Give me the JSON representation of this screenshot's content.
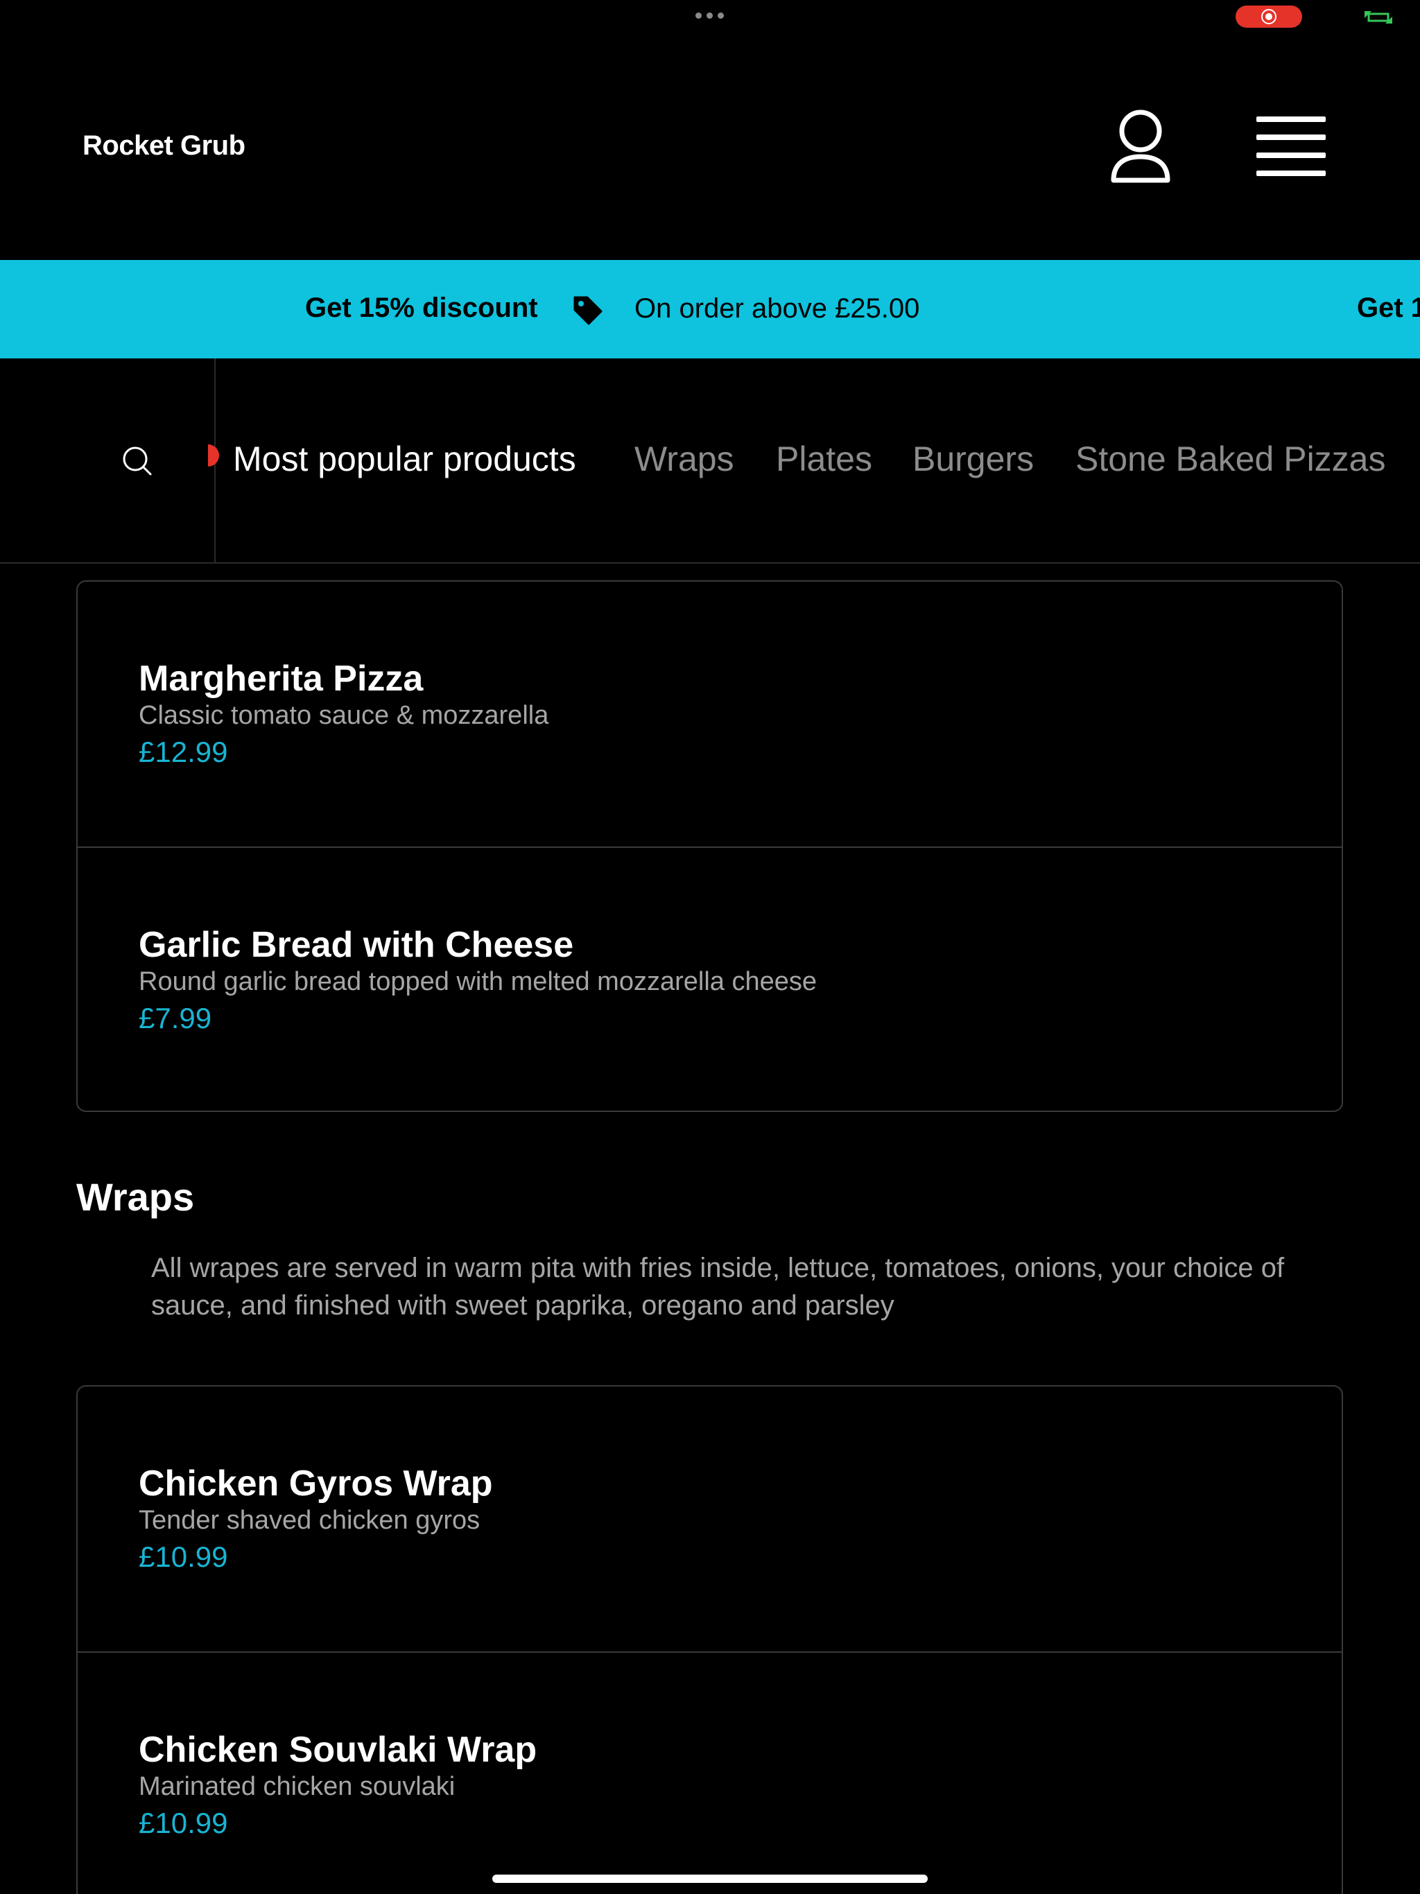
{
  "header": {
    "brand": "Rocket Grub"
  },
  "promo": {
    "title": "Get 15% discount",
    "subtitle": "On order above £25.00",
    "title_repeat": "Get 1"
  },
  "categories": [
    {
      "label": "Most popular products",
      "active": true
    },
    {
      "label": "Wraps",
      "active": false
    },
    {
      "label": "Plates",
      "active": false
    },
    {
      "label": "Burgers",
      "active": false
    },
    {
      "label": "Stone Baked Pizzas",
      "active": false
    }
  ],
  "popular_items": [
    {
      "name": "Margherita Pizza",
      "description": "Classic tomato sauce & mozzarella",
      "price": "£12.99"
    },
    {
      "name": "Garlic Bread with Cheese",
      "description": "Round garlic bread topped with melted mozzarella cheese",
      "price": "£7.99"
    }
  ],
  "wraps": {
    "title": "Wraps",
    "description": "All wrapes are served in warm pita with fries inside, lettuce, tomatoes, onions, your choice of sauce, and finished with sweet paprika, oregano and parsley",
    "items": [
      {
        "name": "Chicken Gyros Wrap",
        "description": "Tender shaved chicken gyros",
        "price": "£10.99"
      },
      {
        "name": "Chicken Souvlaki Wrap",
        "description": "Marinated chicken souvlaki",
        "price": "£10.99"
      }
    ]
  },
  "colors": {
    "background": "#000000",
    "accent": "#0fc2dd",
    "price": "#19b4d2",
    "record": "#e5332a"
  }
}
